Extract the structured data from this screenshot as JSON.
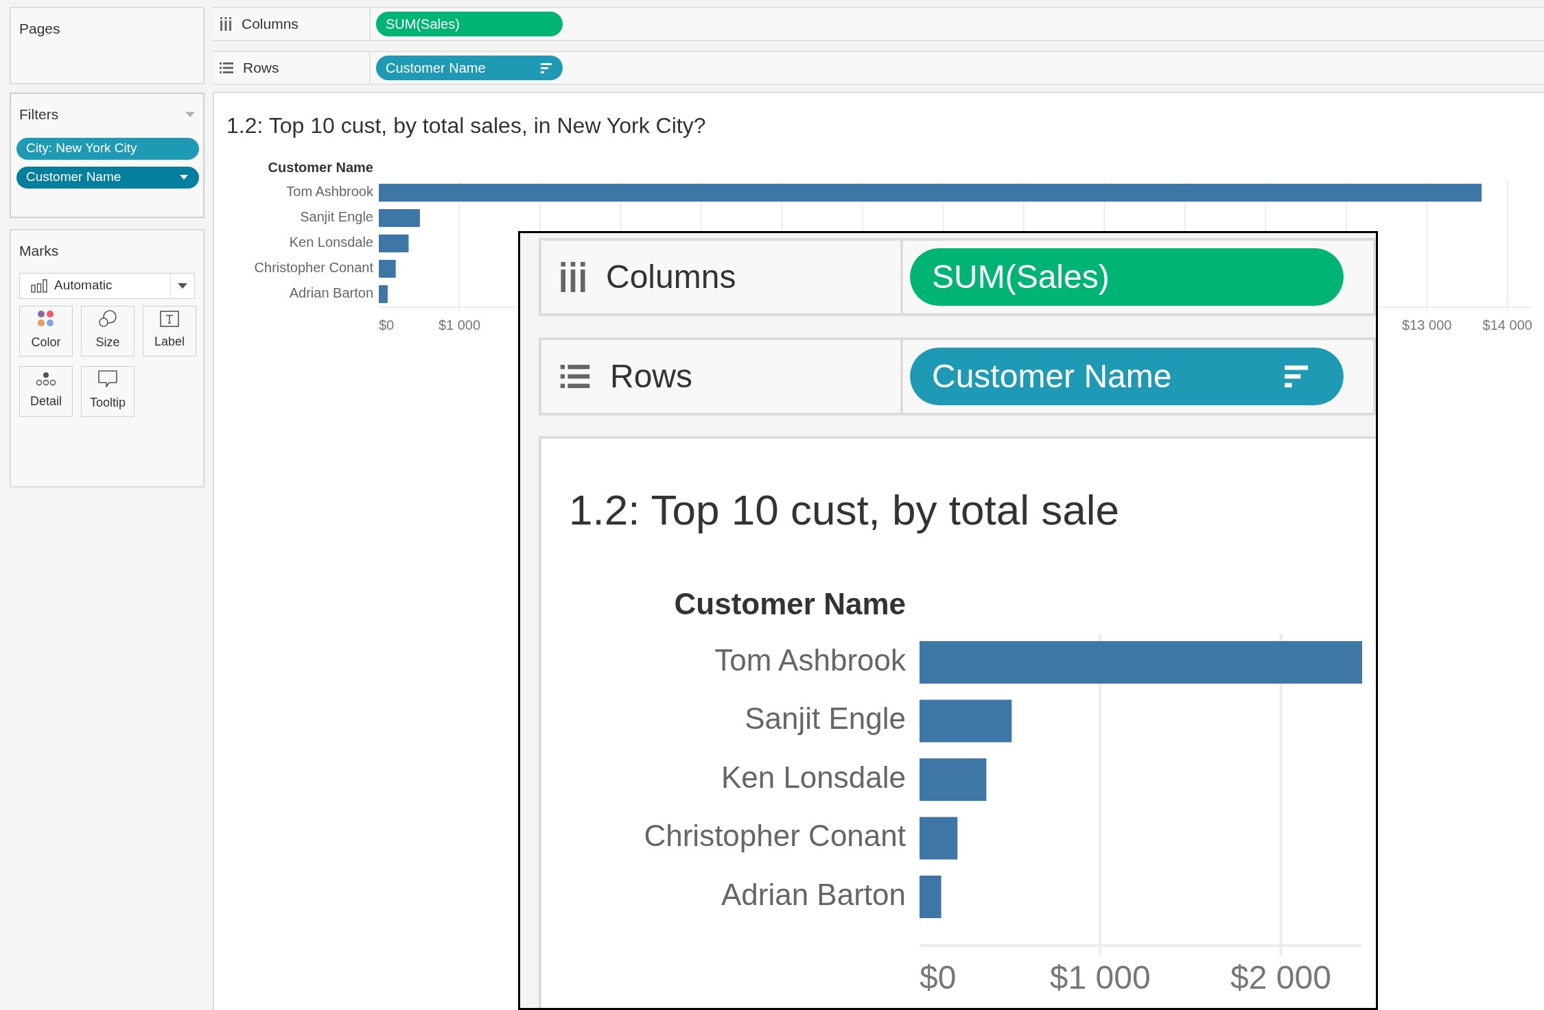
{
  "pages": {
    "title": "Pages"
  },
  "filters": {
    "title": "Filters",
    "pills": [
      {
        "text": "City: New York City",
        "color": "#1f9ab5",
        "dropdown": false
      },
      {
        "text": "Customer Name",
        "color": "#067f9e",
        "dropdown": true
      }
    ]
  },
  "marks": {
    "title": "Marks",
    "mark_type": "Automatic",
    "cards": [
      {
        "label": "Color",
        "kind": "color"
      },
      {
        "label": "Size",
        "kind": "size"
      },
      {
        "label": "Label",
        "kind": "label"
      },
      {
        "label": "Detail",
        "kind": "detail"
      },
      {
        "label": "Tooltip",
        "kind": "tooltip"
      }
    ]
  },
  "shelves": [
    {
      "label": "Columns",
      "kind": "columns",
      "pills": [
        {
          "text": "SUM(Sales)",
          "color": "#00b473",
          "sorted": false
        }
      ]
    },
    {
      "label": "Rows",
      "kind": "rows",
      "pills": [
        {
          "text": "Customer Name",
          "color": "#1f9ab5",
          "sorted": true
        }
      ]
    }
  ],
  "view": {
    "title": "1.2: Top 10 cust, by total sales, in New York City?",
    "row_header": "Customer Name",
    "chart_data": {
      "type": "bar",
      "orientation": "horizontal",
      "categories": [
        "Tom Ashbrook",
        "Sanjit Engle",
        "Ken Lonsdale",
        "Christopher Conant",
        "Adrian Barton"
      ],
      "values": [
        13680,
        510,
        370,
        210,
        110
      ],
      "xlim": [
        0,
        14300
      ],
      "grid": true,
      "xticks": [
        {
          "value": 0,
          "label": "$0"
        },
        {
          "value": 1000,
          "label": "$1 000"
        },
        {
          "value": 13000,
          "label": "$13 000"
        },
        {
          "value": 14000,
          "label": "$14 000"
        }
      ]
    }
  },
  "inset": {
    "shelves": [
      {
        "label": "Columns",
        "kind": "columns",
        "pills": [
          {
            "text": "SUM(Sales)",
            "color": "#00b473",
            "sorted": false
          }
        ]
      },
      {
        "label": "Rows",
        "kind": "rows",
        "pills": [
          {
            "text": "Customer Name",
            "color": "#1f9ab5",
            "sorted": true
          }
        ]
      }
    ],
    "title": "1.2: Top 10 cust, by total sale",
    "row_header": "Customer Name",
    "chart_data": {
      "type": "bar",
      "orientation": "horizontal",
      "categories": [
        "Tom Ashbrook",
        "Sanjit Engle",
        "Ken Lonsdale",
        "Christopher Conant",
        "Adrian Barton"
      ],
      "values": [
        2450,
        510,
        370,
        210,
        120
      ],
      "xlim": [
        0,
        2450
      ],
      "grid": true,
      "xticks": [
        {
          "value": 0,
          "label": "$0"
        },
        {
          "value": 1000,
          "label": "$1 000"
        },
        {
          "value": 2000,
          "label": "$2 000"
        }
      ]
    }
  }
}
